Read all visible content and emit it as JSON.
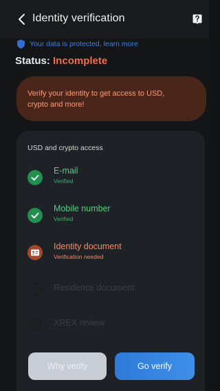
{
  "header": {
    "title": "Identity verification"
  },
  "protection": {
    "text": "Your data is protected, learn more"
  },
  "status": {
    "label": "Status:",
    "value": "Incomplete"
  },
  "alert": {
    "text": "Verify your identity to get access to USD, crypto and more!"
  },
  "access": {
    "title": "USD and crypto access",
    "steps": [
      {
        "name": "E-mail",
        "sub": "Verified",
        "state": "done",
        "icon": "check-icon"
      },
      {
        "name": "Mobile number",
        "sub": "Verified",
        "state": "done",
        "icon": "check-icon"
      },
      {
        "name": "Identity document",
        "sub": "Verification needed",
        "state": "needed",
        "icon": "id-card-icon"
      },
      {
        "name": "Residence document",
        "sub": "",
        "state": "locked",
        "icon": "none"
      },
      {
        "name": "XREX review",
        "sub": "",
        "state": "locked",
        "icon": "none"
      }
    ]
  },
  "actions": {
    "why_label": "Why verify",
    "go_label": "Go verify"
  },
  "colors": {
    "success": "#4fd186",
    "warning": "#ff875f",
    "primary": "#2d7ad9",
    "alert_bg": "#4a251a"
  }
}
